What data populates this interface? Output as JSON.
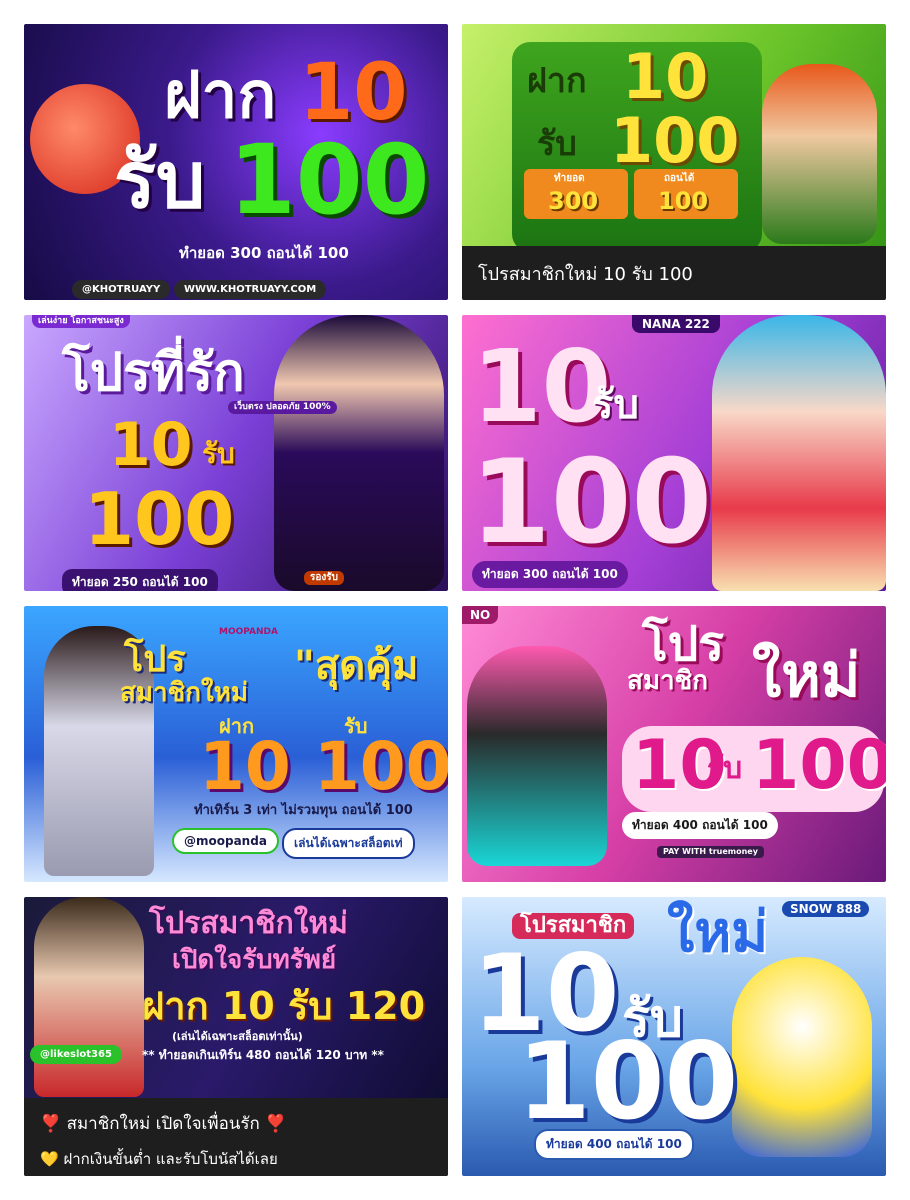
{
  "cards": {
    "card1": {
      "line1_a": "ฝาก",
      "line1_b": "10",
      "line2_a": "รับ",
      "line2_b": "100",
      "subtitle": "ทำยอด 300 ถอนได้ 100",
      "line_id": "@KHOTRUAYY",
      "website": "WWW.KHOTRUAYY.COM"
    },
    "card2": {
      "line1_a": "ฝาก",
      "line1_b": "10",
      "line2_a": "รับ",
      "line2_b": "100",
      "box1_label": "ทำยอด",
      "box1_value": "300",
      "box2_label": "ถอนได้",
      "box2_value": "100",
      "caption": "โปรสมาชิกใหม่ 10 รับ 100"
    },
    "card3": {
      "title": "โปรที่รัก",
      "num1": "10",
      "num1_suffix": "รับ",
      "num2": "100",
      "subtitle": "ทำยอด 250 ถอนได้ 100",
      "tag_top": "เล่นง่าย โอกาสชนะสูง",
      "tag_badge": "เว็บตรง ปลอดภัย 100%",
      "tag_bottom": "รองรับ"
    },
    "card4": {
      "brand": "NANA 222",
      "num1": "10",
      "num1_suffix": "รับ",
      "num2": "100",
      "subtitle": "ทำยอด 300 ถอนได้ 100"
    },
    "card5": {
      "brand": "MOOPANDA",
      "line1": "โปร",
      "line2": "สมาชิกใหม่",
      "line3": "\"สุดคุ้ม",
      "label1": "ฝาก",
      "label2": "รับ",
      "numbers": "10 100",
      "subtitle": "ทำเทิร์น 3 เท่า ไม่รวมทุน ถอนได้ 100",
      "line_id": "@moopanda",
      "only_slots": "เล่นได้เฉพาะสล็อตเท่"
    },
    "card6": {
      "logo": "NO",
      "line1": "โปร",
      "line2": "สมาชิก",
      "line3": "ใหม่",
      "num1": "10",
      "num1_suffix": "รับ",
      "num2": "100",
      "subtitle": "ทำยอด 400 ถอนได้ 100",
      "pay_with": "PAY WITH truemoney"
    },
    "card7": {
      "line1": "โปรสมาชิกใหม่",
      "line2": "เปิดใจรับทรัพย์",
      "line3": "ฝาก 10 รับ 120",
      "note": "(เล่นได้เฉพาะสล็อตเท่านั้น)",
      "terms": "** ทำยอดเกินเทิร์น 480 ถอนได้ 120 บาท **",
      "line_id": "@likeslot365",
      "caption1": "❣️ สมาชิกใหม่ เปิดใจเพื่อนรัก ❣️",
      "caption2": "💛 ฝากเงินขั้นต่ำ และรับโบนัสได้เลย"
    },
    "card8": {
      "brand": "SNOW 888",
      "label": "โปรสมาชิก",
      "line_new": "ใหม่",
      "num1": "10",
      "num1_suffix": "รับ",
      "num2": "100",
      "subtitle": "ทำยอด 400 ถอนได้ 100"
    }
  }
}
